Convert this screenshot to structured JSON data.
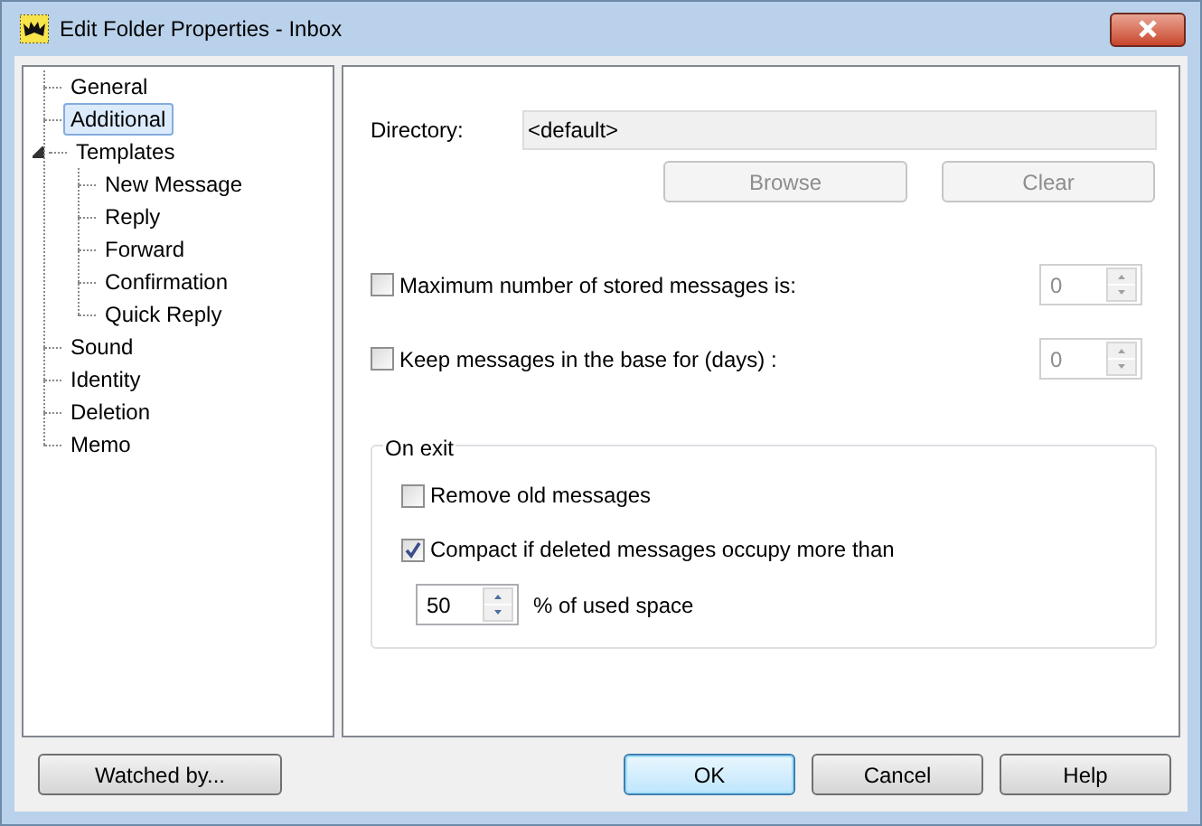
{
  "window": {
    "title": "Edit Folder Properties - Inbox"
  },
  "tree": [
    {
      "label": "General",
      "selected": false
    },
    {
      "label": "Additional",
      "selected": true
    },
    {
      "label": "Templates",
      "selected": false,
      "expanded": true,
      "children": [
        {
          "label": "New Message",
          "selected": false
        },
        {
          "label": "Reply",
          "selected": false
        },
        {
          "label": "Forward",
          "selected": false
        },
        {
          "label": "Confirmation",
          "selected": false
        },
        {
          "label": "Quick Reply",
          "selected": false
        }
      ]
    },
    {
      "label": "Sound",
      "selected": false
    },
    {
      "label": "Identity",
      "selected": false
    },
    {
      "label": "Deletion",
      "selected": false
    },
    {
      "label": "Memo",
      "selected": false
    }
  ],
  "directory": {
    "label": "Directory:",
    "value": "<default>",
    "buttons": [
      {
        "label": "Browse",
        "disabled": true
      },
      {
        "label": "Clear",
        "disabled": true
      }
    ]
  },
  "options": [
    {
      "label": "Maximum number of stored messages is:",
      "checked": false,
      "value": "0"
    },
    {
      "label": "Keep messages in the base for (days) :",
      "checked": false,
      "value": "0"
    }
  ],
  "on_exit": {
    "title": "On exit",
    "options": [
      {
        "label": "Remove old messages",
        "checked": false
      },
      {
        "label": "Compact if deleted messages occupy more than",
        "checked": true
      }
    ],
    "percent": {
      "value": "50",
      "label": "% of used space"
    }
  },
  "buttons": [
    {
      "label": "Watched by...",
      "default": false
    },
    {
      "label": "OK",
      "default": true
    },
    {
      "label": "Cancel",
      "default": false
    },
    {
      "label": "Help",
      "default": false
    }
  ]
}
